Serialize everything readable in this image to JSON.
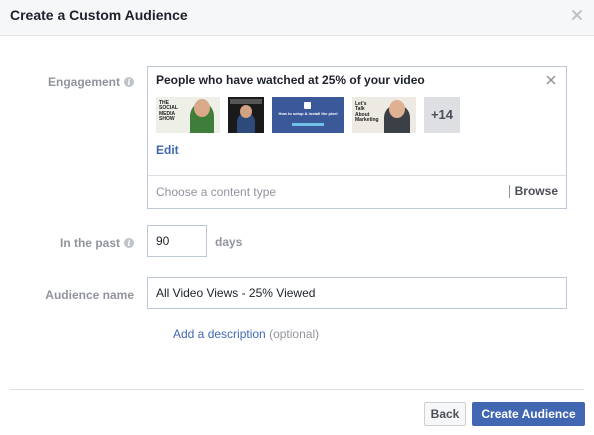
{
  "dialog": {
    "title": "Create a Custom Audience",
    "close_icon": "close-icon"
  },
  "engagement": {
    "label": "Engagement",
    "info_icon": "info-icon",
    "selected_title": "People who have watched at 25% of your video",
    "remove_icon": "remove-icon",
    "thumbnails": [
      {
        "name": "video-thumbnail-1",
        "text": "THE SOCIAL MEDIA SHOW"
      },
      {
        "name": "video-thumbnail-2",
        "text": ""
      },
      {
        "name": "video-thumbnail-3",
        "text": "How to setup & install the pixel"
      },
      {
        "name": "video-thumbnail-4",
        "text": "Let's Talk About Marketing"
      }
    ],
    "more_count": "+14",
    "edit_label": "Edit",
    "content_type_placeholder": "Choose a content type",
    "browse_label": "Browse"
  },
  "past": {
    "label": "In the past",
    "value": "90",
    "unit": "days"
  },
  "audience_name": {
    "label": "Audience name",
    "value": "All Video Views - 25% Viewed"
  },
  "description": {
    "link_label": "Add a description",
    "optional_label": "(optional)"
  },
  "footer": {
    "back_label": "Back",
    "create_label": "Create Audience"
  },
  "colors": {
    "accent": "#4267b2",
    "label_gray": "#90949c",
    "border": "#bdc7d8"
  }
}
